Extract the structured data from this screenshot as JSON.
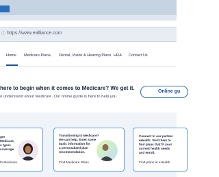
{
  "browser": {
    "url": "https://www.ealliance.com"
  },
  "nav": {
    "items": [
      {
        "label": "Home"
      },
      {
        "label": "Medicare Plans"
      },
      {
        "label": "Dental, Vision & Hearing Plans"
      },
      {
        "label": "HRA"
      },
      {
        "label": "Contact Us"
      }
    ]
  },
  "banner": {
    "title": "here to begin when it comes to Medicare? We get it.",
    "subtitle": "o understand about Medicare. Our online guide is here to help you.",
    "button_label": "Online gu"
  },
  "cards": [
    {
      "lines": [
        "get",
        "Medicare,",
        "e types",
        "coverage"
      ],
      "link": "th Medicare"
    },
    {
      "lines": [
        "Transitioning to Medicare?",
        "We can help. Enter some",
        "basic information for",
        "a personalized plan",
        "recommendation."
      ],
      "link": "Find Medicare Plans"
    },
    {
      "lines": [
        "Connect to our partner",
        "eHealth. Visit them to",
        "find plans that fit your",
        "current health needs",
        "and enroll."
      ],
      "link": "Find plans at eHealth"
    }
  ],
  "colors": {
    "brand_blue": "#1b4f9c",
    "card_border": "#5aa0e6",
    "button_border": "#2a6fbf"
  }
}
